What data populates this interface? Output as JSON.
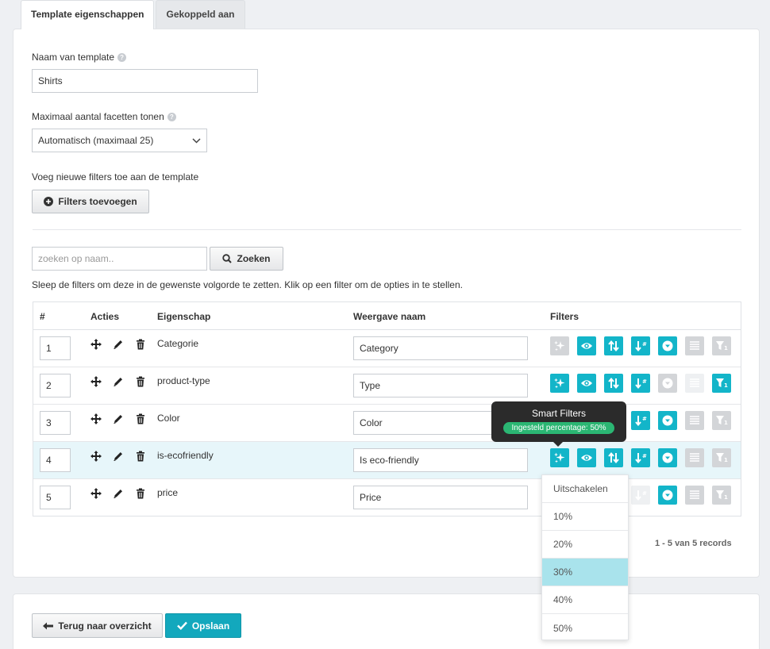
{
  "tabs": [
    {
      "label": "Template eigenschappen",
      "active": true
    },
    {
      "label": "Gekoppeld aan",
      "active": false
    }
  ],
  "form": {
    "name_label": "Naam van template",
    "name_value": "Shirts",
    "max_facets_label": "Maximaal aantal facetten tonen",
    "max_facets_value": "Automatisch (maximaal 25)",
    "add_filters_label": "Voeg nieuwe filters toe aan de template",
    "add_filters_button": "Filters toevoegen"
  },
  "search": {
    "placeholder": "zoeken op naam..",
    "button": "Zoeken",
    "hint": "Sleep de filters om deze in de gewenste volgorde te zetten. Klik op een filter om de opties in te stellen."
  },
  "table": {
    "headers": [
      "#",
      "Acties",
      "Eigenschap",
      "Weergave naam",
      "Filters"
    ],
    "rows": [
      {
        "num": "1",
        "property": "Categorie",
        "display": "Category"
      },
      {
        "num": "2",
        "property": "product-type",
        "display": "Type"
      },
      {
        "num": "3",
        "property": "Color",
        "display": "Color"
      },
      {
        "num": "4",
        "property": "is-ecofriendly",
        "display": "Is eco-friendly"
      },
      {
        "num": "5",
        "property": "price",
        "display": "Price"
      }
    ],
    "records": "1 - 5 van 5 records"
  },
  "tooltip": {
    "title": "Smart Filters",
    "badge": "Ingesteld percentage: 50%"
  },
  "dropdown": {
    "items": [
      "Uitschakelen",
      "10%",
      "20%",
      "30%",
      "40%",
      "50%"
    ],
    "selected": "30%"
  },
  "footer": {
    "back_button": "Terug naar overzicht",
    "save_button": "Opslaan"
  },
  "colors": {
    "accent": "#13b5c9",
    "highlight_row": "#e7f6fa",
    "selected_option": "#a9e3ec",
    "badge_green": "#2bb673"
  }
}
